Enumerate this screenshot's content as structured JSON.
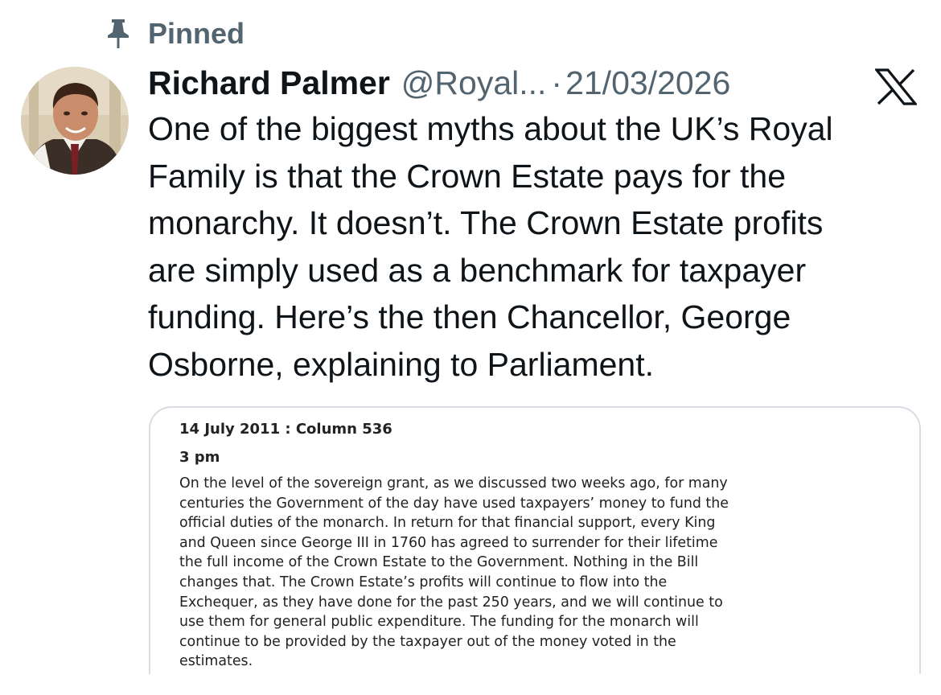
{
  "pinned": {
    "label": "Pinned",
    "icon": "pin-icon"
  },
  "tweet": {
    "author_name": "Richard Palmer",
    "handle": "@Royal...",
    "separator": "·",
    "date": "21/03/2026",
    "platform_icon": "x-logo-icon",
    "text_lines": [
      "One of the biggest myths about the UK’s Royal",
      "Family is that the Crown Estate pays for the",
      "monarchy. It doesn’t. The Crown Estate profits",
      "are simply used as a benchmark for taxpayer",
      "funding. Here’s the then Chancellor, George",
      "Osborne, explaining to Parliament."
    ]
  },
  "media": {
    "heading": "14 July 2011 : Column 536",
    "time": "3 pm",
    "body_lines": [
      "On the level of the sovereign grant, as we discussed two weeks ago, for many",
      "centuries the Government of the day have used taxpayers’ money to fund the",
      "official duties of the monarch. In return for that financial support, every King",
      "and Queen since George III in 1760 has agreed to surrender for their lifetime",
      "the full income of the Crown Estate to the Government. Nothing in the Bill",
      "changes that. The Crown Estate’s profits will continue to flow into the",
      "Exchequer, as they have done for the past 250 years, and we will continue to",
      "use them for general public expenditure. The funding for the monarch will",
      "continue to be provided by the taxpayer out of the money voted in the",
      "estimates."
    ]
  },
  "colors": {
    "text_primary": "#0f1419",
    "text_secondary": "#536471",
    "card_border": "#d7dde2"
  }
}
